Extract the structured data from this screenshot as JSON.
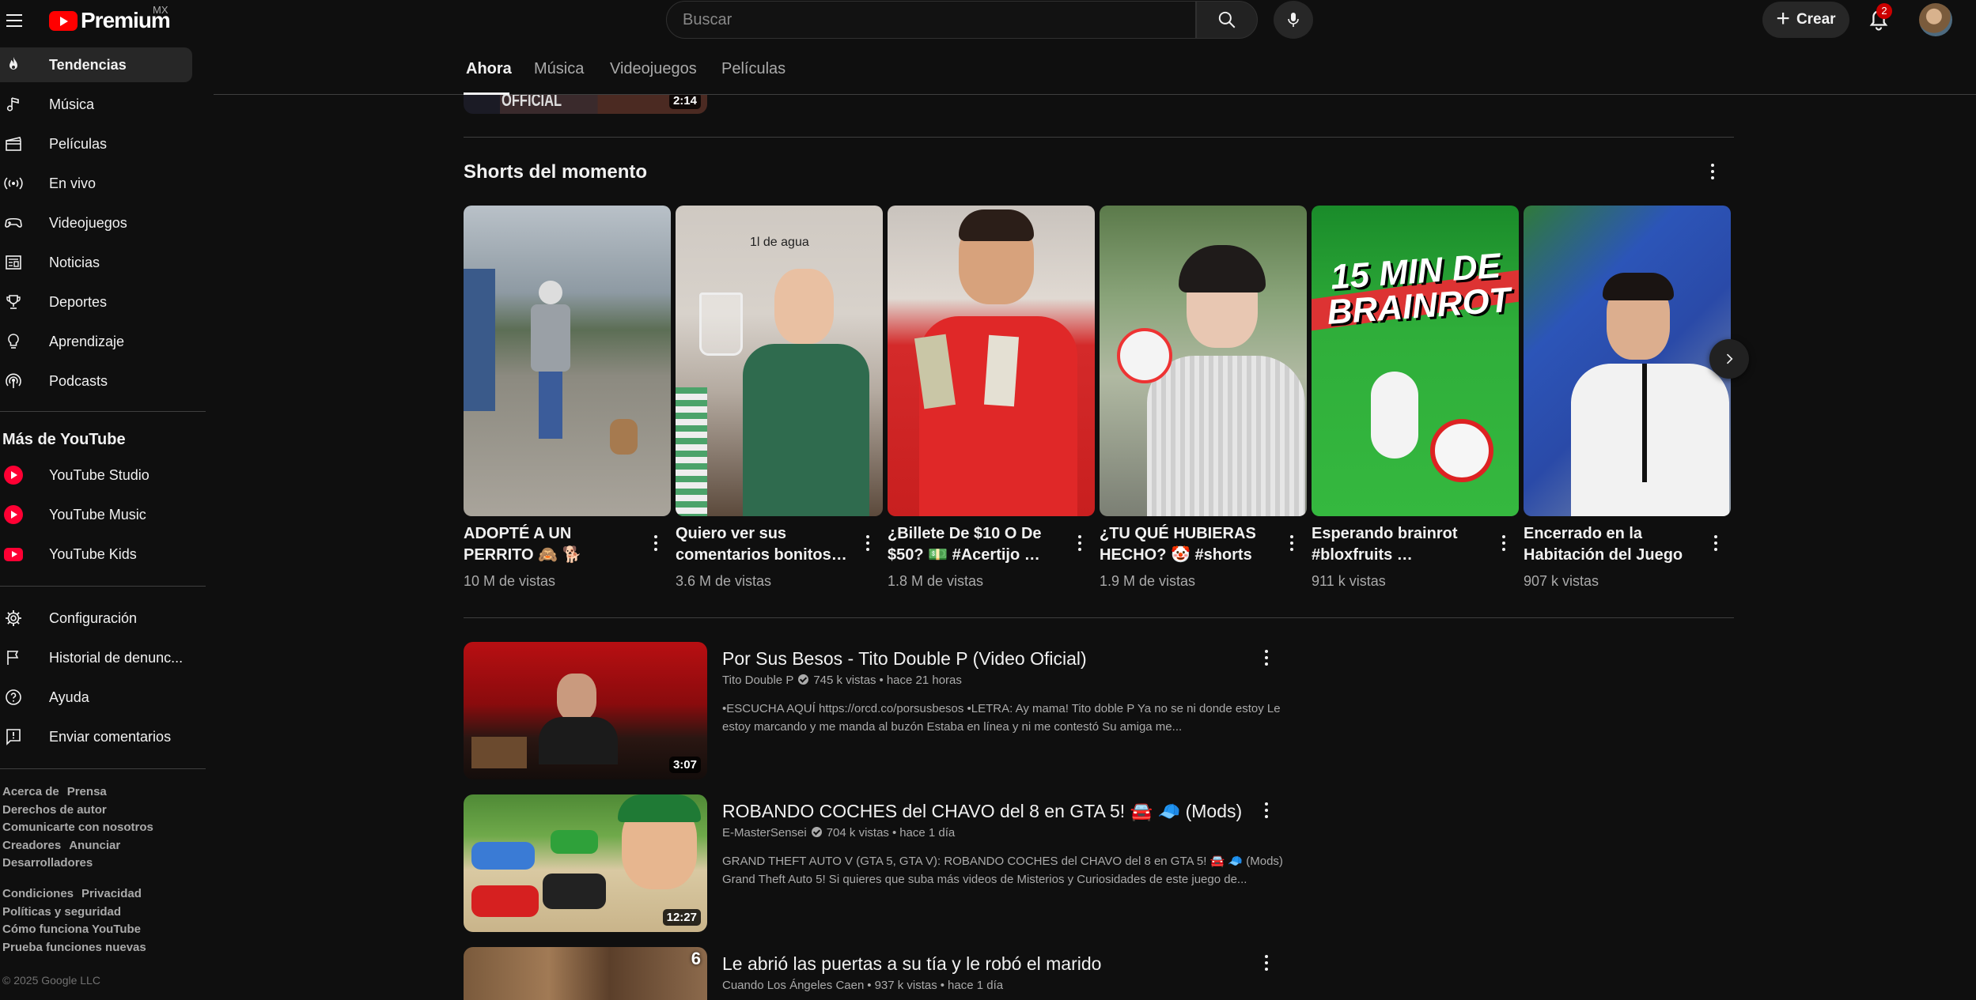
{
  "header": {
    "logo_text": "Premium",
    "logo_country": "MX",
    "search_placeholder": "Buscar",
    "create_label": "Crear",
    "notifications_count": "2"
  },
  "sidebar": {
    "main_items": [
      {
        "label": "Tendencias",
        "icon": "flame-icon",
        "active": true
      },
      {
        "label": "Música",
        "icon": "music-note-icon"
      },
      {
        "label": "Películas",
        "icon": "clapperboard-icon"
      },
      {
        "label": "En vivo",
        "icon": "live-icon"
      },
      {
        "label": "Videojuegos",
        "icon": "gamepad-icon"
      },
      {
        "label": "Noticias",
        "icon": "newspaper-icon"
      },
      {
        "label": "Deportes",
        "icon": "trophy-icon"
      },
      {
        "label": "Aprendizaje",
        "icon": "lightbulb-icon"
      },
      {
        "label": "Podcasts",
        "icon": "podcast-icon"
      }
    ],
    "more_heading": "Más de YouTube",
    "more_items": [
      {
        "label": "YouTube Studio",
        "icon": "youtube-studio-icon"
      },
      {
        "label": "YouTube Music",
        "icon": "youtube-music-icon"
      },
      {
        "label": "YouTube Kids",
        "icon": "youtube-kids-icon"
      }
    ],
    "settings_items": [
      {
        "label": "Configuración",
        "icon": "gear-icon"
      },
      {
        "label": "Historial de denunc...",
        "icon": "flag-icon"
      },
      {
        "label": "Ayuda",
        "icon": "help-icon"
      },
      {
        "label": "Enviar comentarios",
        "icon": "feedback-icon"
      }
    ],
    "footer_group1": [
      [
        "Acerca de",
        "Prensa"
      ],
      [
        "Derechos de autor"
      ],
      [
        "Comunicarte con nosotros"
      ],
      [
        "Creadores",
        "Anunciar"
      ],
      [
        "Desarrolladores"
      ]
    ],
    "footer_group2": [
      [
        "Condiciones",
        "Privacidad"
      ],
      [
        "Políticas y seguridad"
      ],
      [
        "Cómo funciona YouTube"
      ],
      [
        "Prueba funciones nuevas"
      ]
    ],
    "copyright": "© 2025 Google LLC"
  },
  "tabs": [
    {
      "label": "Ahora",
      "active": true
    },
    {
      "label": "Música"
    },
    {
      "label": "Videojuegos"
    },
    {
      "label": "Películas"
    }
  ],
  "previous_video": {
    "thumb_text": "OFFICIAL",
    "duration": "2:14"
  },
  "shorts_shelf": {
    "title": "Shorts del momento",
    "items": [
      {
        "title": "ADOPTÉ A UN PERRITO 🙈 🐕",
        "views": "10 M de vistas"
      },
      {
        "title": "Quiero ver sus comentarios bonitos…",
        "views": "3.6 M de vistas",
        "overlay": "1l de agua"
      },
      {
        "title": "¿Billete De $10 O De $50? 💵 #Acertijo …",
        "views": "1.8 M de vistas"
      },
      {
        "title": "¿TU QUÉ HUBIERAS HECHO? 🤡 #shorts",
        "views": "1.9 M de vistas"
      },
      {
        "title": "Esperando brainrot #bloxfruits …",
        "views": "911 k vistas",
        "overlay": "15 MIN DE BRAINROT"
      },
      {
        "title": "Encerrado en la Habitación del Juego …",
        "views": "907 k vistas"
      }
    ]
  },
  "videos": [
    {
      "title": "Por Sus Besos - Tito Double P (Video Oficial)",
      "channel": "Tito Double P",
      "views": "745 k vistas",
      "age": "hace 21 horas",
      "description": "•ESCUCHA AQUÍ https://orcd.co/porsusbesos •LETRA: Ay mama! Tito doble P Ya no se ni donde estoy Le estoy marcando y me manda al buzón Estaba en línea y ni me contestó Su amiga me...",
      "duration": "3:07"
    },
    {
      "title": "ROBANDO COCHES del CHAVO del 8 en GTA 5! 🚘 🧢 (Mods)",
      "channel": "E-MasterSensei",
      "views": "704 k vistas",
      "age": "hace 1 día",
      "description": "GRAND THEFT AUTO V (GTA 5, GTA V): ROBANDO COCHES del CHAVO del 8 en GTA 5! 🚘 🧢 (Mods) Grand Theft Auto 5! Si quieres que suba más videos de Misterios y Curiosidades de este juego de...",
      "duration": "12:27"
    },
    {
      "title": "Le abrió las puertas a su tía y le robó el marido",
      "channel": "Cuando Los Ángeles Caen",
      "views": "937 k vistas",
      "age": "hace 1 día",
      "badge": "6"
    }
  ],
  "colors": {
    "background": "#0f0f0f",
    "accent_red": "#ff0000",
    "text_primary": "#f1f1f1",
    "text_secondary": "#aaaaaa",
    "badge_red": "#cc0000"
  }
}
